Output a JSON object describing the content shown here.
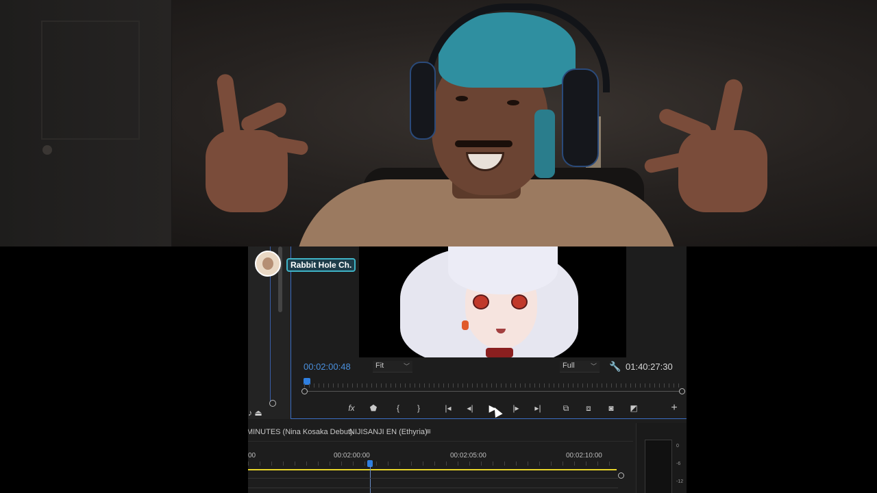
{
  "monitor": {
    "channel_name": "Rabbit Hole Ch.",
    "timecode_current": "00:02:00:48",
    "zoom_select": "Fit",
    "resolution_select": "Full",
    "timecode_duration": "01:40:27:30"
  },
  "transport": {
    "fx_label": "fx",
    "marker_icon": "marker-icon",
    "in_icon": "mark-in-icon",
    "out_icon": "mark-out-icon",
    "goto_in_icon": "go-to-in-icon",
    "step_back_icon": "step-back-icon",
    "play_icon": "play-icon",
    "step_forward_icon": "step-forward-icon",
    "goto_out_icon": "go-to-out-icon",
    "lift_icon": "lift-icon",
    "extract_icon": "extract-icon",
    "export_frame_icon": "camera-icon",
    "compare_icon": "compare-icon",
    "add_icon": "plus-icon"
  },
  "sequence": {
    "tab1": "MINUTES (Nina Kosaka Debut)",
    "tab2": "NIJISANJI EN (Ethyria)",
    "menu_glyph": "≡",
    "ticks": [
      "00",
      "00:02:00:00",
      "00:02:05:00",
      "00:02:10:00"
    ]
  },
  "meter": {
    "labels": [
      "0",
      "-6",
      "-12"
    ]
  }
}
